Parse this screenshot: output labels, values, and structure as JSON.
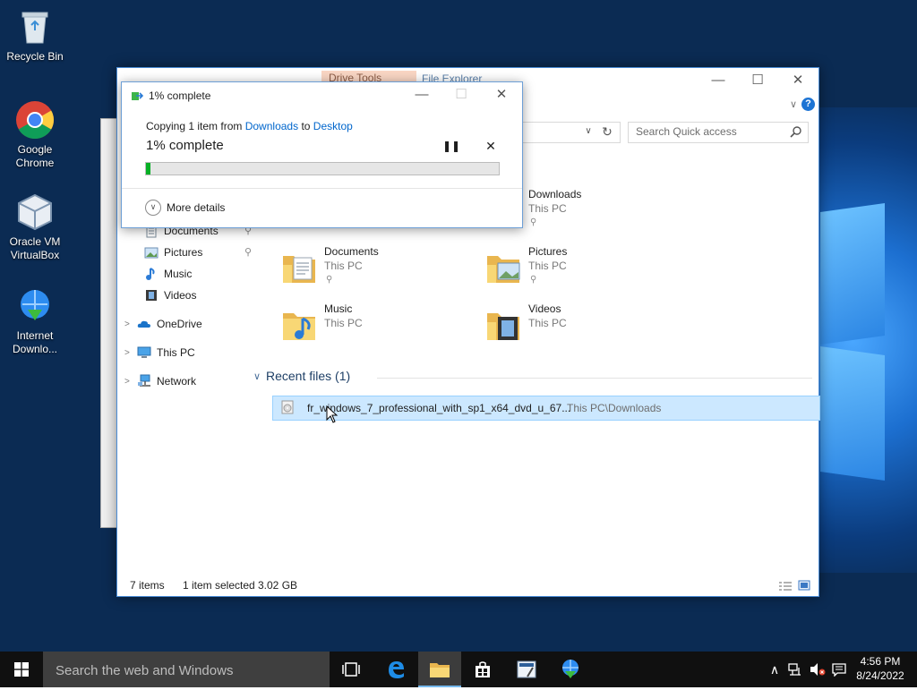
{
  "desktop": {
    "icons": [
      {
        "label": "Recycle Bin",
        "icon": "recycle-bin-icon"
      },
      {
        "label": "Google Chrome",
        "icon": "chrome-icon"
      },
      {
        "label": "Oracle VM VirtualBox",
        "icon": "virtualbox-icon"
      },
      {
        "label": "Internet Downlo...",
        "icon": "internet-download-manager-icon"
      }
    ]
  },
  "explorer": {
    "context_tab": "Drive Tools",
    "title": "File Explorer",
    "search_placeholder": "Search Quick access",
    "nav": {
      "documents": "Documents",
      "pictures": "Pictures",
      "music": "Music",
      "videos": "Videos",
      "onedrive": "OneDrive",
      "this_pc": "This PC",
      "network": "Network"
    },
    "folders": [
      {
        "name": "Downloads",
        "location": "This PC"
      },
      {
        "name": "Documents",
        "location": "This PC"
      },
      {
        "name": "Pictures",
        "location": "This PC"
      },
      {
        "name": "Music",
        "location": "This PC"
      },
      {
        "name": "Videos",
        "location": "This PC"
      }
    ],
    "recent_header": "Recent files (1)",
    "recent_files": [
      {
        "name": "fr_windows_7_professional_with_sp1_x64_dvd_u_67...",
        "path": "This PC\\Downloads"
      }
    ],
    "status": {
      "items": "7 items",
      "selected": "1 item selected",
      "size": "3.02 GB"
    }
  },
  "copy_dialog": {
    "title": "1% complete",
    "copying_prefix": "Copying 1 item from",
    "source": "Downloads",
    "to_word": "to",
    "destination": "Desktop",
    "progress_label": "1% complete",
    "progress_percent": 1,
    "more_details": "More details"
  },
  "taskbar": {
    "search_placeholder": "Search the web and Windows",
    "clock_time": "4:56 PM",
    "clock_date": "8/24/2022"
  },
  "colors": {
    "accent": "#0078d7",
    "progress": "#06b025",
    "selection": "#cce8ff",
    "link": "#0066cc"
  }
}
